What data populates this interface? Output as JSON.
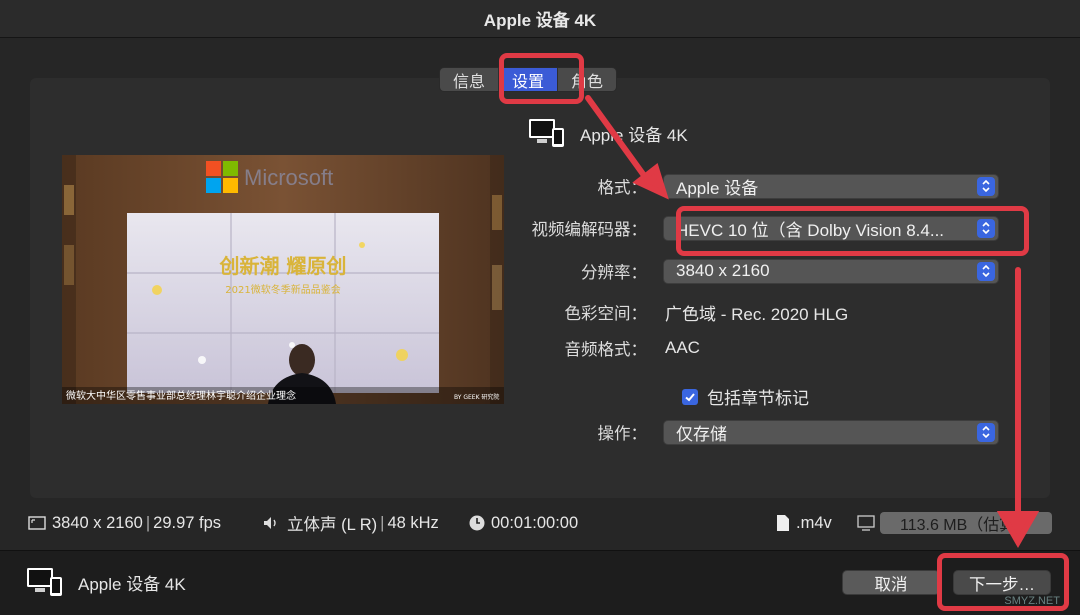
{
  "window": {
    "title": "Apple 设备 4K"
  },
  "tabs": [
    {
      "label": "信息",
      "active": false
    },
    {
      "label": "设置",
      "active": true
    },
    {
      "label": "角色",
      "active": false
    }
  ],
  "preset": {
    "name": "Apple 设备 4K",
    "icon": "apple-devices-icon"
  },
  "preview": {
    "brand": "Microsoft",
    "headline": "创新潮 耀原创",
    "subheadline": "2021微软冬季新品品鉴会",
    "caption": "微软大中华区零售事业部总经理林宇聪介绍企业理念",
    "credit": "BY GEEK 研究院"
  },
  "settings": {
    "format": {
      "label": "格式：",
      "value": "Apple 设备"
    },
    "codec": {
      "label": "视频编解码器：",
      "value": "HEVC 10 位（含 Dolby Vision 8.4..."
    },
    "resolution": {
      "label": "分辨率：",
      "value": "3840 x 2160"
    },
    "color_space": {
      "label": "色彩空间：",
      "value": "广色域 - Rec. 2020 HLG"
    },
    "audio_format": {
      "label": "音频格式：",
      "value": "AAC"
    },
    "chapters": {
      "label": "包括章节标记",
      "checked": true
    },
    "action": {
      "label": "操作：",
      "value": "仅存储"
    }
  },
  "status": {
    "resolution": "3840 x 2160",
    "fps": "29.97 fps",
    "audio": "立体声 (L R)",
    "sample_rate": "48 kHz",
    "duration": "00:01:00:00",
    "extension": ".m4v",
    "size": "113.6 MB（估算）"
  },
  "footer": {
    "preset_name": "Apple 设备 4K",
    "cancel_label": "取消",
    "next_label": "下一步…"
  },
  "watermark": "SMYZ.NET",
  "colors": {
    "accent": "#3b5bd6",
    "highlight": "#e03a45"
  }
}
